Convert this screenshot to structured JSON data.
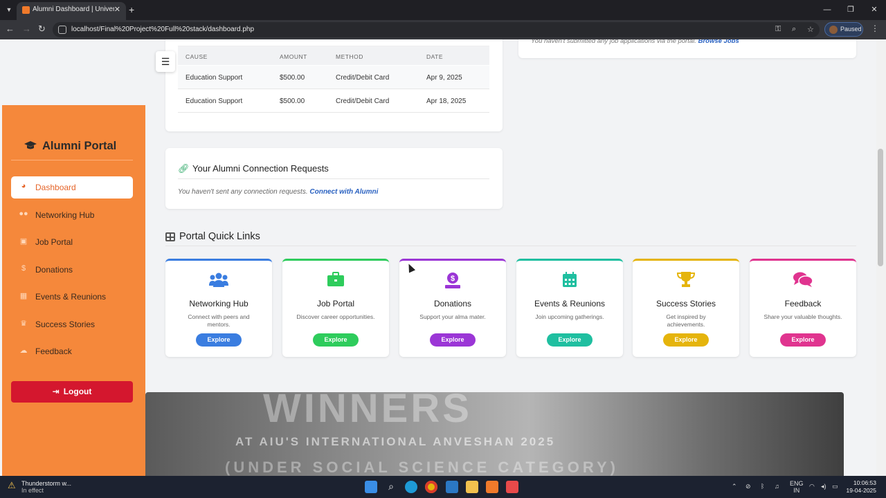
{
  "browser": {
    "tab_title": "Alumni Dashboard | University",
    "url": "localhost/Final%20Project%20Full%20stack/dashboard.php",
    "profile_status": "Paused"
  },
  "jobs_card": {
    "empty_text": "You haven't submitted any job applications via the portal.",
    "link": "Browse Jobs"
  },
  "donations_table": {
    "headers": [
      "CAUSE",
      "AMOUNT",
      "METHOD",
      "DATE"
    ],
    "rows": [
      {
        "cause": "Education Support",
        "amount": "$500.00",
        "method": "Credit/Debit Card",
        "date": "Apr 9, 2025"
      },
      {
        "cause": "Education Support",
        "amount": "$500.00",
        "method": "Credit/Debit Card",
        "date": "Apr 18, 2025"
      }
    ]
  },
  "connections": {
    "title": "Your Alumni Connection Requests",
    "empty_text": "You haven't sent any connection requests.",
    "link": "Connect with Alumni"
  },
  "quick_links": {
    "title": "Portal Quick Links",
    "cards": [
      {
        "title": "Networking Hub",
        "desc": "Connect with peers and mentors.",
        "button": "Explore",
        "color": "#3a7de0",
        "icon": "users-icon"
      },
      {
        "title": "Job Portal",
        "desc": "Discover career opportunities.",
        "button": "Explore",
        "color": "#2ecc5c",
        "icon": "briefcase-icon"
      },
      {
        "title": "Donations",
        "desc": "Support your alma mater.",
        "button": "Explore",
        "color": "#9b36d6",
        "icon": "donate-icon"
      },
      {
        "title": "Events & Reunions",
        "desc": "Join upcoming gatherings.",
        "button": "Explore",
        "color": "#1fbfa0",
        "icon": "calendar-icon"
      },
      {
        "title": "Success Stories",
        "desc": "Get inspired by achievements.",
        "button": "Explore",
        "color": "#e5b40c",
        "icon": "trophy-icon"
      },
      {
        "title": "Feedback",
        "desc": "Share your valuable thoughts.",
        "button": "Explore",
        "color": "#e0348f",
        "icon": "comments-icon"
      }
    ]
  },
  "sidebar": {
    "brand": "Alumni Portal",
    "items": [
      {
        "label": "Dashboard",
        "icon": "dashboard-icon",
        "active": true
      },
      {
        "label": "Networking Hub",
        "icon": "users-icon"
      },
      {
        "label": "Job Portal",
        "icon": "briefcase-icon"
      },
      {
        "label": "Donations",
        "icon": "donate-icon"
      },
      {
        "label": "Events & Reunions",
        "icon": "calendar-icon"
      },
      {
        "label": "Success Stories",
        "icon": "trophy-icon"
      },
      {
        "label": "Feedback",
        "icon": "comments-icon"
      }
    ],
    "logout": "Logout"
  },
  "banner": {
    "line1": "WINNERS",
    "line2": "AT AIU'S INTERNATIONAL ANVESHAN 2025",
    "line3": "(UNDER SOCIAL SCIENCE CATEGORY)"
  },
  "taskbar": {
    "weather_title": "Thunderstorm w...",
    "weather_sub": "In effect",
    "lang1": "ENG",
    "lang2": "IN",
    "time": "10:06:53",
    "date": "19-04-2025"
  }
}
